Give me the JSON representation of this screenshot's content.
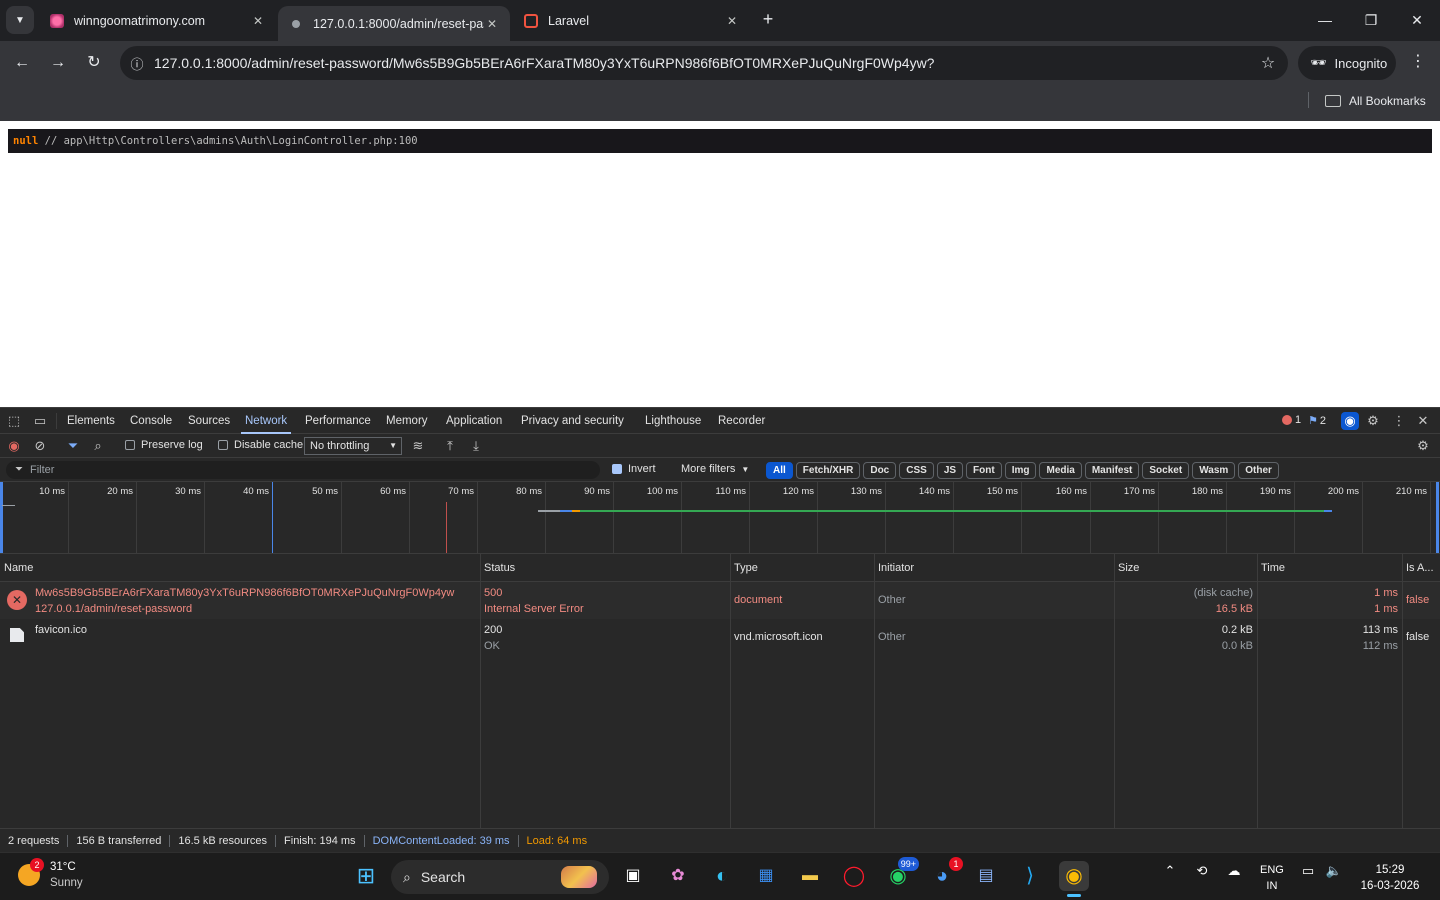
{
  "browser": {
    "tabs": [
      {
        "title": "winngoomatrimony.com",
        "close": "✕"
      },
      {
        "title": "127.0.0.1:8000/admin/reset-pas",
        "close": "✕"
      },
      {
        "title": "Laravel",
        "close": "✕"
      }
    ],
    "new_tab": "+",
    "url": "127.0.0.1:8000/admin/reset-password/Mw6s5B9Gb5BErA6rFXaraTM80y3YxT6uRPN986f6BfOT0MRXePJuQuNrgF0Wp4yw?",
    "incognito_label": "Incognito",
    "bookmarks_label": "All Bookmarks"
  },
  "page": {
    "dump_null": "null",
    "dump_path": "// app\\Http\\Controllers\\admins\\Auth\\LoginController.php:100"
  },
  "devtools": {
    "tabs": [
      "Elements",
      "Console",
      "Sources",
      "Network",
      "Performance",
      "Memory",
      "Application",
      "Privacy and security",
      "Lighthouse",
      "Recorder"
    ],
    "active_tab": "Network",
    "error_count": "1",
    "issue_count": "2",
    "controls": {
      "preserve_log": "Preserve log",
      "disable_cache": "Disable cache",
      "throttling": "No throttling",
      "filter_placeholder": "Filter",
      "invert": "Invert",
      "more_filters": "More filters"
    },
    "filter_chips": [
      "All",
      "Fetch/XHR",
      "Doc",
      "CSS",
      "JS",
      "Font",
      "Img",
      "Media",
      "Manifest",
      "Socket",
      "Wasm",
      "Other"
    ],
    "timeline_ticks": [
      "10 ms",
      "20 ms",
      "30 ms",
      "40 ms",
      "50 ms",
      "60 ms",
      "70 ms",
      "80 ms",
      "90 ms",
      "100 ms",
      "110 ms",
      "120 ms",
      "130 ms",
      "140 ms",
      "150 ms",
      "160 ms",
      "170 ms",
      "180 ms",
      "190 ms",
      "200 ms",
      "210 ms"
    ],
    "columns": [
      "Name",
      "Status",
      "Type",
      "Initiator",
      "Size",
      "Time",
      "Is A..."
    ],
    "rows": [
      {
        "name": "Mw6s5B9Gb5BErA6rFXaraTM80y3YxT6uRPN986f6BfOT0MRXePJuQuNrgF0Wp4yw",
        "path": "127.0.0.1/admin/reset-password",
        "status": "500",
        "status_text": "Internal Server Error",
        "type": "document",
        "initiator": "Other",
        "size": "(disk cache)",
        "size2": "16.5 kB",
        "time": "1 ms",
        "time2": "1 ms",
        "is_ad": "false"
      },
      {
        "name": "favicon.ico",
        "path": "",
        "status": "200",
        "status_text": "OK",
        "type": "vnd.microsoft.icon",
        "initiator": "Other",
        "size": "0.2 kB",
        "size2": "0.0 kB",
        "time": "113 ms",
        "time2": "112 ms",
        "is_ad": "false"
      }
    ],
    "status_bar": {
      "requests": "2 requests",
      "transferred": "156 B transferred",
      "resources": "16.5 kB resources",
      "finish": "Finish: 194 ms",
      "dom_loaded": "DOMContentLoaded: 39 ms",
      "load": "Load: 64 ms"
    }
  },
  "taskbar": {
    "weather_temp": "31°C",
    "weather_desc": "Sunny",
    "weather_badge": "2",
    "search_label": "Search",
    "whatsapp_badge": "99+",
    "app_badge": "1",
    "lang_top": "ENG",
    "lang_bottom": "IN",
    "time": "15:29",
    "date": "16-03-2026"
  }
}
